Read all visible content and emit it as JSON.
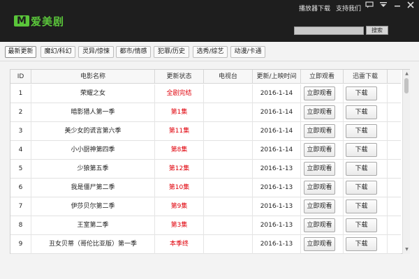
{
  "app": {
    "logo_mark": "M",
    "logo_text": "爱美剧",
    "brand_color": "#5ac53a"
  },
  "topbar": {
    "links": [
      "播放器下载",
      "支持我们"
    ],
    "icons": [
      "chat-icon",
      "menu-icon",
      "minimize-icon",
      "close-icon"
    ]
  },
  "search": {
    "value": "",
    "button_label": "搜索"
  },
  "tabs": [
    {
      "label": "最新更新",
      "active": true
    },
    {
      "label": "魔幻/科幻",
      "active": false
    },
    {
      "label": "灵异/惊悚",
      "active": false
    },
    {
      "label": "都市/情感",
      "active": false
    },
    {
      "label": "犯罪/历史",
      "active": false
    },
    {
      "label": "选秀/综艺",
      "active": false
    },
    {
      "label": "动漫/卡通",
      "active": false
    }
  ],
  "table": {
    "columns": [
      "ID",
      "电影名称",
      "更新状态",
      "电视台",
      "更新/上映时间",
      "立即观看",
      "迅雷下载"
    ],
    "watch_label": "立即观看",
    "download_label": "下载",
    "rows": [
      {
        "id": "1",
        "name": "荣耀之女",
        "status": "全剧完结",
        "channel": "",
        "date": "2016-1-14"
      },
      {
        "id": "2",
        "name": "暗影猎人第一季",
        "status": "第1集",
        "channel": "",
        "date": "2016-1-14"
      },
      {
        "id": "3",
        "name": "美少女的谎言第六季",
        "status": "第11集",
        "channel": "",
        "date": "2016-1-14"
      },
      {
        "id": "4",
        "name": "小小厨神第四季",
        "status": "第8集",
        "channel": "",
        "date": "2016-1-14"
      },
      {
        "id": "5",
        "name": "少狼第五季",
        "status": "第12集",
        "channel": "",
        "date": "2016-1-13"
      },
      {
        "id": "6",
        "name": "我是僵尸第二季",
        "status": "第10集",
        "channel": "",
        "date": "2016-1-13"
      },
      {
        "id": "7",
        "name": "伊莎贝尔第二季",
        "status": "第9集",
        "channel": "",
        "date": "2016-1-13"
      },
      {
        "id": "8",
        "name": "王室第二季",
        "status": "第3集",
        "channel": "",
        "date": "2016-1-13"
      },
      {
        "id": "9",
        "name": "丑女贝蒂（哥伦比亚版）第一季",
        "status": "本季终",
        "channel": "",
        "date": "2016-1-13"
      }
    ],
    "status_color": "#e0000a"
  }
}
